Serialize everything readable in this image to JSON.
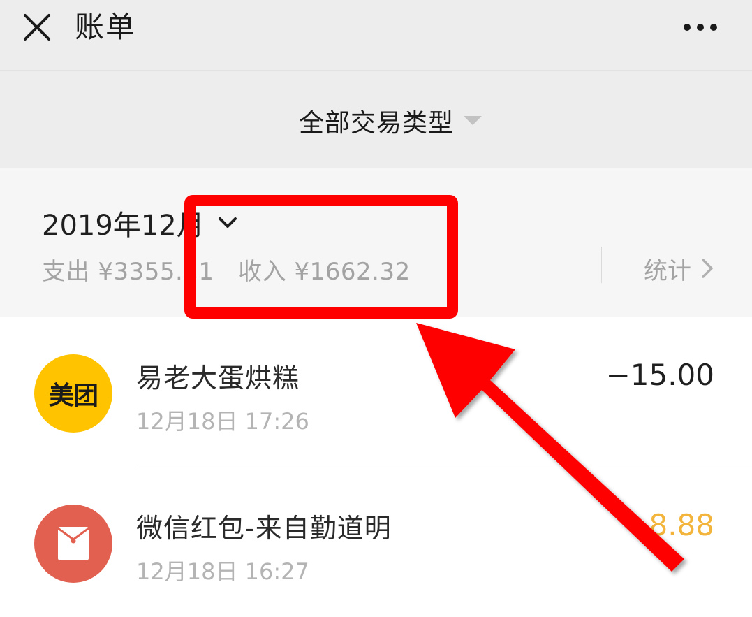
{
  "header": {
    "title": "账单",
    "close_icon": "close-icon",
    "more_icon": "more-icon"
  },
  "filter": {
    "label": "全部交易类型",
    "icon": "caret-down-icon"
  },
  "summary": {
    "month": "2019年12月",
    "expense_label": "支出",
    "expense_value": "¥3355.11",
    "income_label": "收入",
    "income_value": "¥1662.32",
    "stats_label": "统计"
  },
  "transactions": [
    {
      "name": "易老大蛋烘糕",
      "time": "12月18日 17:26",
      "amount": "−15.00",
      "logo_text": "美团",
      "logo_color": "#ffc300",
      "amount_color": "#1f1f1f"
    },
    {
      "name": "微信红包-来自勤道明",
      "time": "12月18日 16:27",
      "amount": "8.88",
      "logo_icon": "red-packet-icon",
      "logo_color": "#e2604f",
      "amount_color": "#f2b43a"
    }
  ],
  "colors": {
    "accent_annotation": "#ff0000",
    "background": "#ededed"
  }
}
